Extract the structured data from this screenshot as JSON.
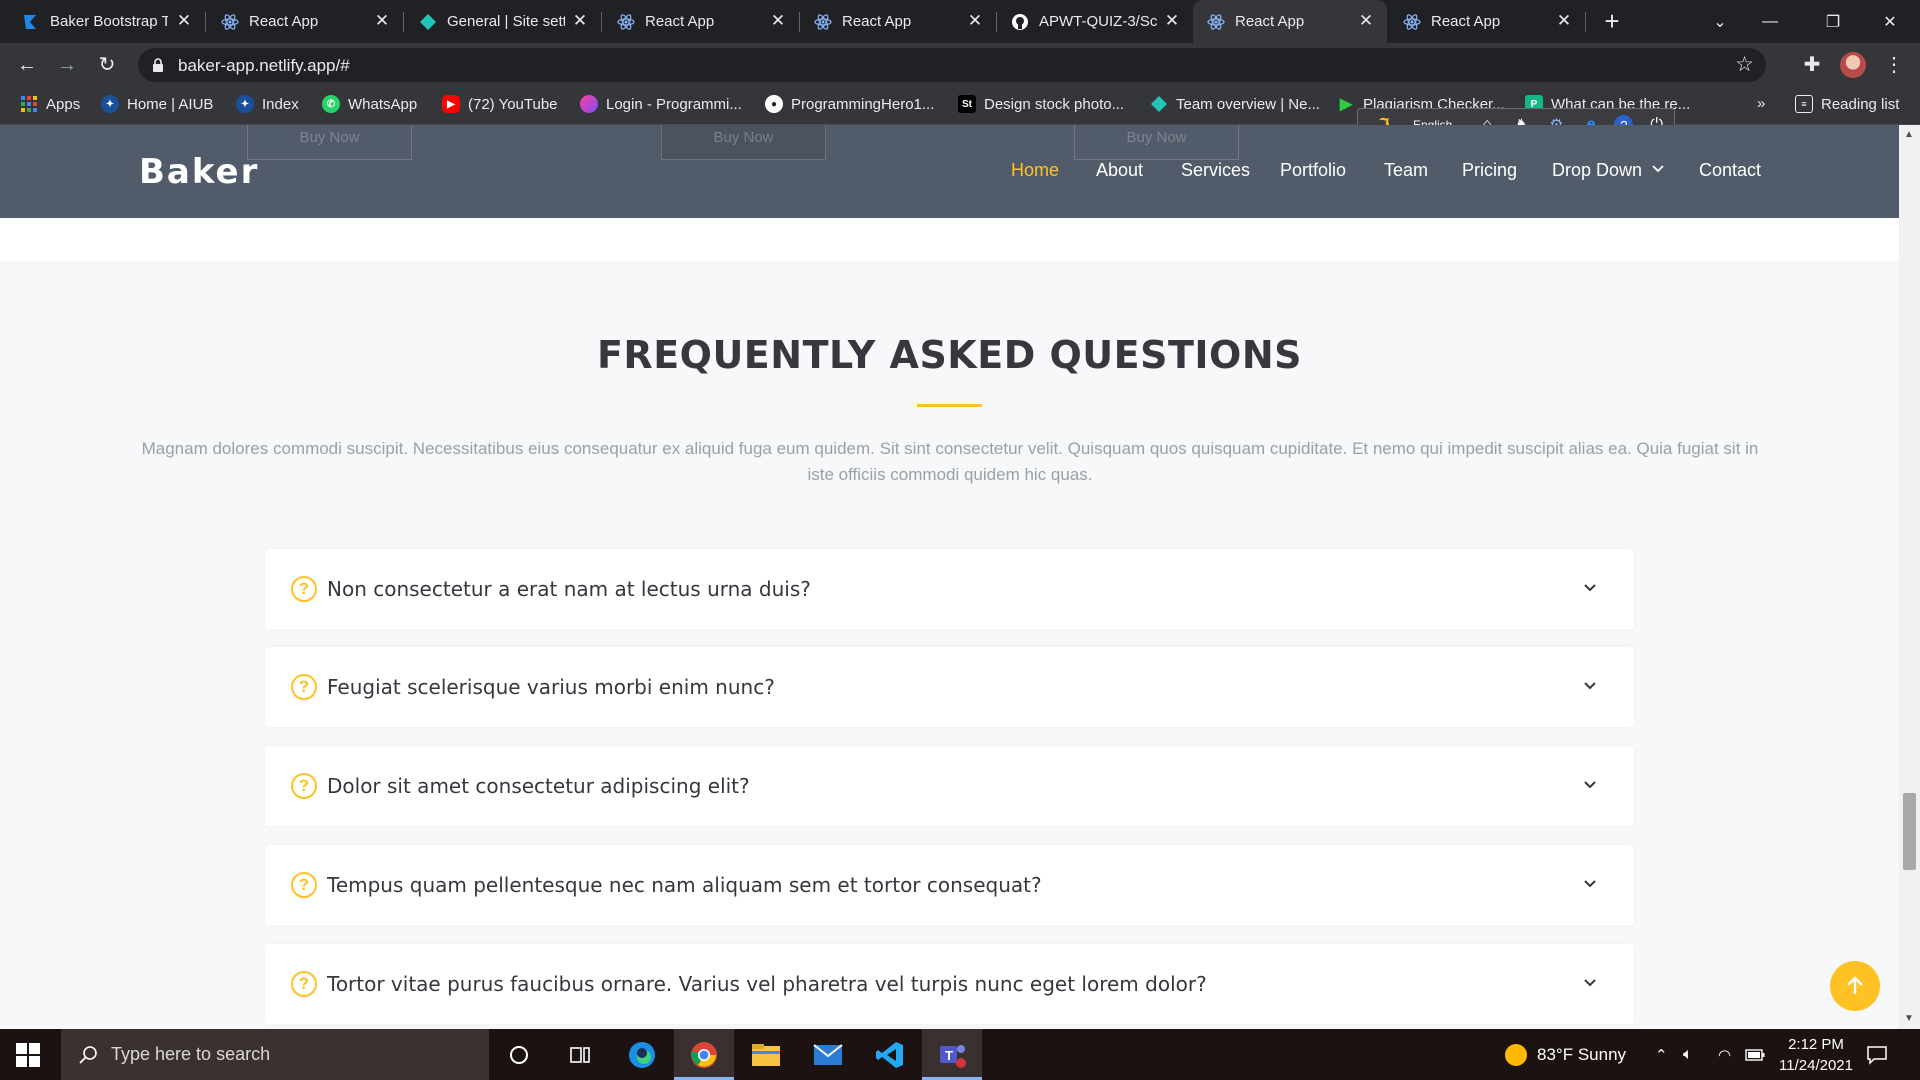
{
  "browser": {
    "tabs": [
      {
        "title": "Baker Bootstrap T",
        "icon": "baker-logo-icon",
        "active": false
      },
      {
        "title": "React App",
        "icon": "react-icon",
        "active": false
      },
      {
        "title": "General | Site sett",
        "icon": "netlify-diamond-icon",
        "active": false
      },
      {
        "title": "React App",
        "icon": "react-icon",
        "active": false
      },
      {
        "title": "React App",
        "icon": "react-icon",
        "active": false
      },
      {
        "title": "APWT-QUIZ-3/Sc",
        "icon": "github-icon",
        "active": false
      },
      {
        "title": "React App",
        "icon": "react-icon",
        "active": true
      },
      {
        "title": "React App",
        "icon": "react-icon",
        "active": false
      }
    ],
    "url": "baker-app.netlify.app/#",
    "bookmarks": [
      {
        "label": "Apps",
        "icon": "apps-grid-icon"
      },
      {
        "label": "Home | AIUB",
        "icon": "aiub-icon"
      },
      {
        "label": "Index",
        "icon": "aiub-icon"
      },
      {
        "label": "WhatsApp",
        "icon": "whatsapp-icon"
      },
      {
        "label": "(72) YouTube",
        "icon": "youtube-icon"
      },
      {
        "label": "Login - Programmi...",
        "icon": "programming-hero-icon"
      },
      {
        "label": "ProgrammingHero1...",
        "icon": "github-icon"
      },
      {
        "label": "Design stock photo...",
        "icon": "shutterstock-icon"
      },
      {
        "label": "Team overview | Ne...",
        "icon": "netlify-diamond-icon"
      },
      {
        "label": "Plagiarism Checker...",
        "icon": "plagiarism-icon"
      },
      {
        "label": "What can be the re...",
        "icon": "bookmark-icon"
      }
    ],
    "reading_list": "Reading list",
    "more_bookmarks": "»",
    "dict_language": "English"
  },
  "site": {
    "logo": "Baker",
    "nav": [
      "Home",
      "About",
      "Services",
      "Portfolio",
      "Team",
      "Pricing",
      "Drop Down",
      "Contact"
    ],
    "ghost_buttons": [
      "Buy Now",
      "Buy Now",
      "Buy Now"
    ],
    "accent_color": "#ffc224",
    "header_color": "#525b6a"
  },
  "faq": {
    "title": "FREQUENTLY ASKED QUESTIONS",
    "description": "Magnam dolores commodi suscipit. Necessitatibus eius consequatur ex aliquid fuga eum quidem. Sit sint consectetur velit. Quisquam quos quisquam cupiditate. Et nemo qui impedit suscipit alias ea. Quia fugiat sit in iste officiis commodi quidem hic quas.",
    "items": [
      "Non consectetur a erat nam at lectus urna duis?",
      "Feugiat scelerisque varius morbi enim nunc?",
      "Dolor sit amet consectetur adipiscing elit?",
      "Tempus quam pellentesque nec nam aliquam sem et tortor consequat?",
      "Tortor vitae purus faucibus ornare. Varius vel pharetra vel turpis nunc eget lorem dolor?"
    ]
  },
  "taskbar": {
    "search_placeholder": "Type here to search",
    "weather": "83°F  Sunny",
    "time": "2:12 PM",
    "date": "11/24/2021"
  }
}
